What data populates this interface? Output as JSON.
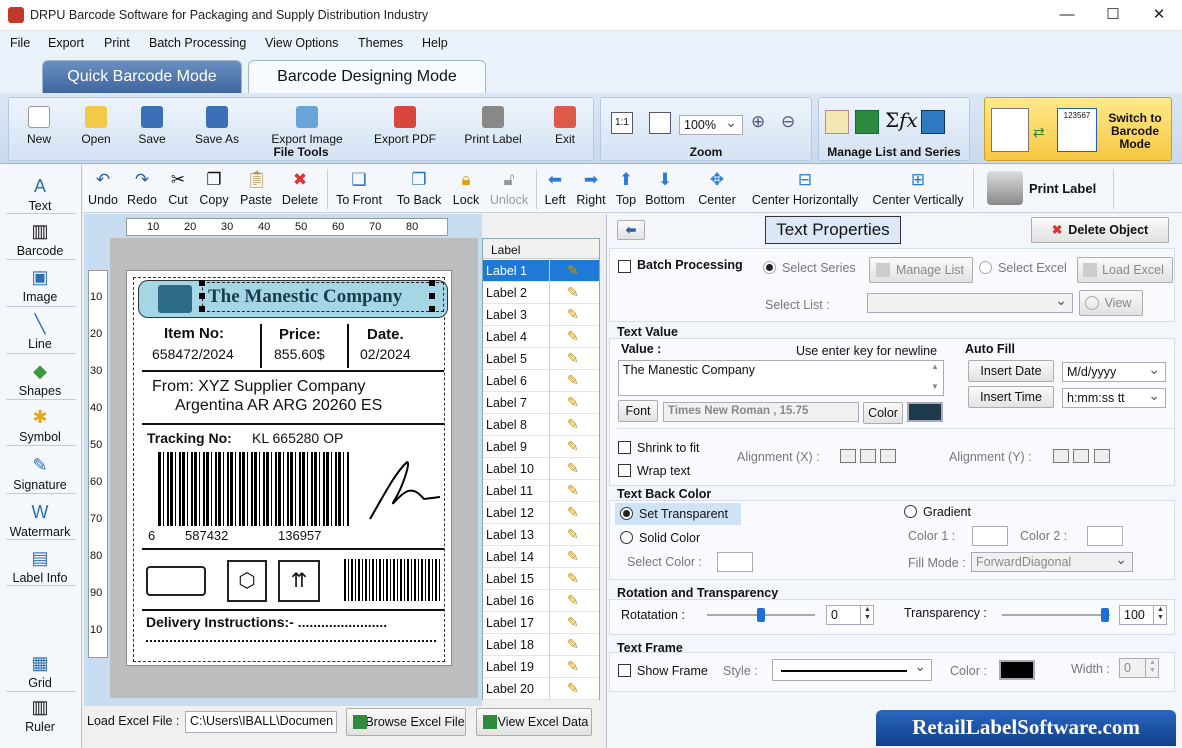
{
  "window": {
    "title": "DRPU Barcode Software for Packaging and Supply Distribution Industry",
    "minimize": "—",
    "maximize": "☐",
    "close": "✕"
  },
  "menu": [
    "File",
    "Export",
    "Print",
    "Batch Processing",
    "View Options",
    "Themes",
    "Help"
  ],
  "modes": {
    "quick": "Quick Barcode Mode",
    "designing": "Barcode Designing Mode"
  },
  "ribbon": {
    "file_tools": {
      "label": "File Tools",
      "buttons": [
        "New",
        "Open",
        "Save",
        "Save As",
        "Export Image",
        "Export PDF",
        "Print Label",
        "Exit"
      ]
    },
    "zoom": {
      "label": "Zoom",
      "value": "100%"
    },
    "manage": {
      "label": "Manage List and Series"
    },
    "switch": {
      "label": "Switch to Barcode Mode",
      "icon_text": "123567"
    }
  },
  "toolbar": {
    "buttons": [
      "Undo",
      "Redo",
      "Cut",
      "Copy",
      "Paste",
      "Delete",
      "To Front",
      "To Back",
      "Lock",
      "Unlock",
      "Left",
      "Right",
      "Top",
      "Bottom",
      "Center",
      "Center Horizontally",
      "Center Vertically"
    ],
    "print_label": "Print Label"
  },
  "leftbar": [
    "Text",
    "Barcode",
    "Image",
    "Line",
    "Shapes",
    "Symbol",
    "Signature",
    "Watermark",
    "Label Info",
    "Grid",
    "Ruler"
  ],
  "ruler": {
    "h": [
      "10",
      "20",
      "30",
      "40",
      "50",
      "60",
      "70",
      "80"
    ],
    "v": [
      "10",
      "20",
      "30",
      "40",
      "50",
      "60",
      "70",
      "80",
      "90",
      "10"
    ]
  },
  "label_design": {
    "company": "The Manestic Company",
    "item_no_label": "Item No:",
    "item_no": "658472/2024",
    "price_label": "Price:",
    "price": "855.60$",
    "date_label": "Date.",
    "date": "02/2024",
    "from_line1": "From:  XYZ Supplier Company",
    "from_line2": "Argentina AR ARG 20260 ES",
    "tracking_label": "Tracking No:",
    "tracking": "KL 665280 OP",
    "barcode_digits": [
      "6",
      "587432",
      "136957"
    ],
    "delivery": "Delivery Instructions:- ......................."
  },
  "label_list": {
    "header": "Label",
    "items": [
      "Label 1",
      "Label 2",
      "Label 3",
      "Label 4",
      "Label 5",
      "Label 6",
      "Label 7",
      "Label 8",
      "Label 9",
      "Label 10",
      "Label 11",
      "Label 12",
      "Label 13",
      "Label 14",
      "Label 15",
      "Label 16",
      "Label 17",
      "Label 18",
      "Label 19",
      "Label 20"
    ],
    "selected": 0
  },
  "load_excel": {
    "label": "Load Excel File :",
    "path": "C:\\Users\\IBALL\\Documen",
    "browse": "Browse Excel File",
    "view": "View Excel Data"
  },
  "props": {
    "title": "Text Properties",
    "delete": "Delete Object",
    "batch": "Batch Processing",
    "select_series": "Select Series",
    "manage_list": "Manage List",
    "select_excel": "Select Excel",
    "load_excel": "Load Excel",
    "select_list": "Select List :",
    "view": "View",
    "text_value": "Text Value",
    "value_label": "Value :",
    "hint": "Use enter key for newline",
    "value": "The Manestic Company",
    "font_btn": "Font",
    "font": "Times New Roman , 15.75",
    "color_btn": "Color",
    "text_color": "#1c3a4a",
    "auto_fill": "Auto Fill",
    "insert_date": "Insert Date",
    "date_fmt": "M/d/yyyy",
    "insert_time": "Insert Time",
    "time_fmt": "h:mm:ss tt",
    "shrink": "Shrink to fit",
    "wrap": "Wrap text",
    "align_x": "Alignment (X) :",
    "align_y": "Alignment (Y) :",
    "back_color": "Text Back Color",
    "transparent": "Set Transparent",
    "solid": "Solid Color",
    "select_color": "Select Color :",
    "gradient": "Gradient",
    "color1": "Color 1 :",
    "color2": "Color 2 :",
    "fill_mode": "Fill Mode :",
    "fill_mode_val": "ForwardDiagonal",
    "rotation_head": "Rotation and Transparency",
    "rotation": "Rotatation :",
    "rotation_val": "0",
    "transparency": "Transparency :",
    "transparency_val": "100",
    "frame_head": "Text Frame",
    "show_frame": "Show Frame",
    "style": "Style :",
    "color": "Color :",
    "width": "Width :",
    "width_val": "0"
  },
  "brand": "RetailLabelSoftware.com"
}
